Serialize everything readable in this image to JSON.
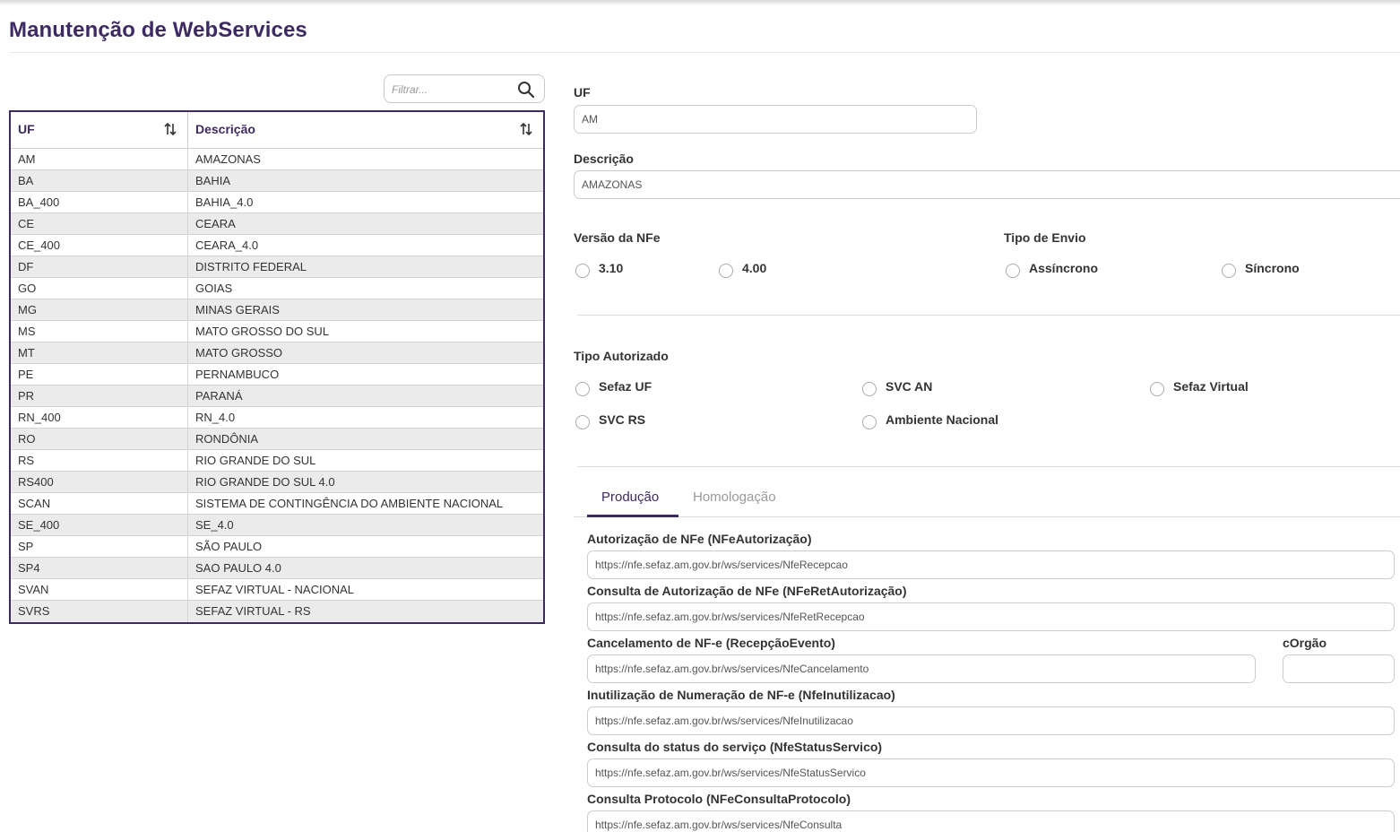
{
  "page": {
    "title": "Manutenção de WebServices"
  },
  "filter": {
    "placeholder": "Filtrar..."
  },
  "table": {
    "headers": [
      "UF",
      "Descrição"
    ],
    "rows": [
      [
        "AM",
        "AMAZONAS"
      ],
      [
        "BA",
        "BAHIA"
      ],
      [
        "BA_400",
        "BAHIA_4.0"
      ],
      [
        "CE",
        "CEARA"
      ],
      [
        "CE_400",
        "CEARA_4.0"
      ],
      [
        "DF",
        "DISTRITO FEDERAL"
      ],
      [
        "GO",
        "GOIAS"
      ],
      [
        "MG",
        "MINAS GERAIS"
      ],
      [
        "MS",
        "MATO GROSSO DO SUL"
      ],
      [
        "MT",
        "MATO GROSSO"
      ],
      [
        "PE",
        "PERNAMBUCO"
      ],
      [
        "PR",
        "PARANÁ"
      ],
      [
        "RN_400",
        "RN_4.0"
      ],
      [
        "RO",
        "RONDÔNIA"
      ],
      [
        "RS",
        "RIO GRANDE DO SUL"
      ],
      [
        "RS400",
        "RIO GRANDE DO SUL 4.0"
      ],
      [
        "SCAN",
        "SISTEMA DE CONTINGÊNCIA DO AMBIENTE NACIONAL"
      ],
      [
        "SE_400",
        "SE_4.0"
      ],
      [
        "SP",
        "SÃO PAULO"
      ],
      [
        "SP4",
        "SAO PAULO 4.0"
      ],
      [
        "SVAN",
        "SEFAZ VIRTUAL - NACIONAL"
      ],
      [
        "SVRS",
        "SEFAZ VIRTUAL - RS"
      ]
    ]
  },
  "form": {
    "uf_label": "UF",
    "uf_value": "AM",
    "descricao_label": "Descrição",
    "descricao_value": "AMAZONAS",
    "versao_label": "Versão da NFe",
    "versao_options": [
      "3.10",
      "4.00"
    ],
    "tipo_envio_label": "Tipo de Envio",
    "tipo_envio_options": [
      "Assíncrono",
      "Síncrono"
    ],
    "tipo_autorizado_label": "Tipo Autorizado",
    "tipo_autorizado_options": [
      "Sefaz UF",
      "SVC AN",
      "Sefaz Virtual",
      "SVC RS",
      "Ambiente Nacional"
    ]
  },
  "tabs": {
    "producao": "Produção",
    "homologacao": "Homologação"
  },
  "webservices": {
    "autorizacao_label": "Autorização de NFe (NFeAutorização)",
    "autorizacao_value": "https://nfe.sefaz.am.gov.br/ws/services/NfeRecepcao",
    "consulta_autorizacao_label": "Consulta de Autorização de NFe (NFeRetAutorização)",
    "consulta_autorizacao_value": "https://nfe.sefaz.am.gov.br/ws/services/NfeRetRecepcao",
    "cancelamento_label": "Cancelamento de NF-e (RecepçãoEvento)",
    "cancelamento_value": "https://nfe.sefaz.am.gov.br/ws/services/NfeCancelamento",
    "corgao_label": "cOrgão",
    "corgao_value": "",
    "inutilizacao_label": "Inutilização de Numeração de NF-e (NfeInutilizacao)",
    "inutilizacao_value": "https://nfe.sefaz.am.gov.br/ws/services/NfeInutilizacao",
    "status_label": "Consulta do status do serviço (NfeStatusServico)",
    "status_value": "https://nfe.sefaz.am.gov.br/ws/services/NfeStatusServico",
    "protocolo_label": "Consulta Protocolo (NFeConsultaProtocolo)",
    "protocolo_value": "https://nfe.sefaz.am.gov.br/ws/services/NfeConsulta"
  },
  "colors": {
    "accent": "#3d2a63",
    "row_alt": "#ebebeb"
  }
}
